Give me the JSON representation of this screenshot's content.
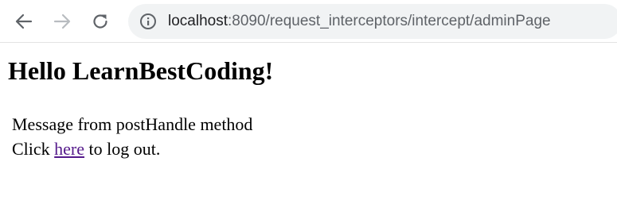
{
  "browser": {
    "url_host": "localhost",
    "url_rest": ":8090/request_interceptors/intercept/adminPage",
    "icons": {
      "back": "back-arrow-icon",
      "forward": "forward-arrow-icon",
      "reload": "reload-icon",
      "site_info": "info-icon"
    },
    "forward_disabled": true
  },
  "page": {
    "heading": "Hello LearnBestCoding!",
    "message": "Message from postHandle method",
    "logout_prefix": "Click ",
    "logout_link": "here",
    "logout_suffix": " to log out.",
    "link_color": "#551a8b"
  }
}
